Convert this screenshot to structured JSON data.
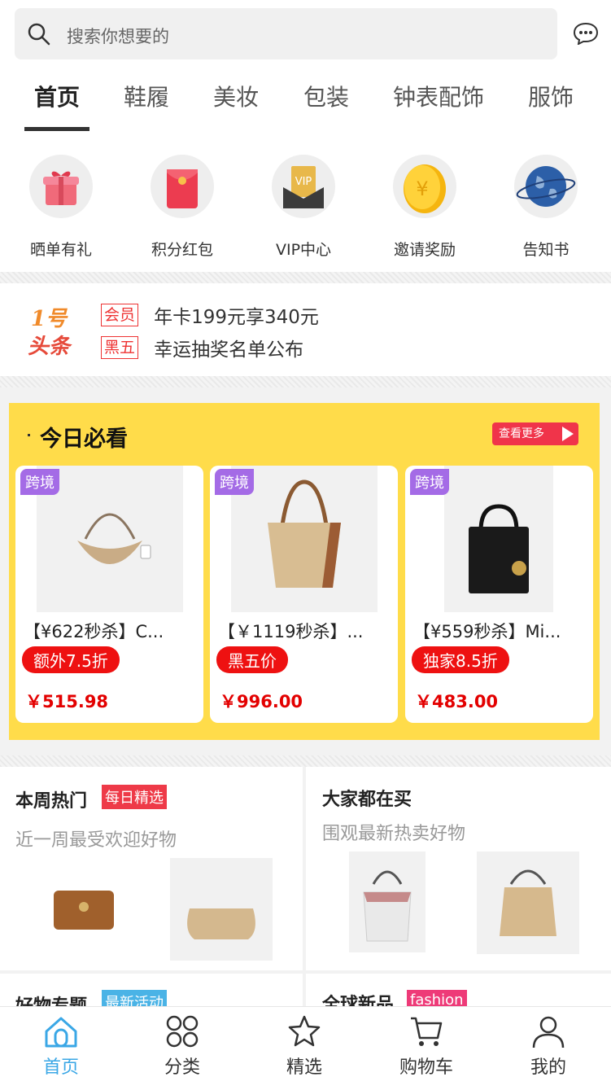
{
  "search": {
    "placeholder": "搜索你想要的"
  },
  "tabs": [
    "首页",
    "鞋履",
    "美妆",
    "包装",
    "钟表配饰",
    "服饰"
  ],
  "quick_links": [
    {
      "label": "晒单有礼",
      "icon": "gift-icon"
    },
    {
      "label": "积分红包",
      "icon": "red-envelope-icon"
    },
    {
      "label": "VIP中心",
      "icon": "vip-card-icon"
    },
    {
      "label": "邀请奖励",
      "icon": "gold-coin-icon"
    },
    {
      "label": "告知书",
      "icon": "globe-icon"
    }
  ],
  "news": {
    "logo_text": "1号头条",
    "items": [
      {
        "tag": "会员",
        "text": "年卡199元享340元"
      },
      {
        "tag": "黑五",
        "text": "幸运抽奖名单公布"
      }
    ]
  },
  "must_see": {
    "title": "今日必看",
    "more": "查看更多",
    "products": [
      {
        "badge": "跨境",
        "name": "【¥622秒杀】C...",
        "promo": "额外7.5折",
        "price": "￥515.98"
      },
      {
        "badge": "跨境",
        "name": "【￥1119秒杀】...",
        "promo": "黑五价",
        "price": "￥996.00"
      },
      {
        "badge": "跨境",
        "name": "【¥559秒杀】Mi...",
        "promo": "独家8.5折",
        "price": "￥483.00"
      }
    ]
  },
  "sections": [
    {
      "title": "本周热门",
      "tag": "每日精选",
      "subtitle": "近一周最受欢迎好物"
    },
    {
      "title": "大家都在买",
      "tag": "",
      "subtitle": "围观最新热卖好物"
    },
    {
      "title": "好物专题",
      "tag": "最新活动",
      "subtitle": ""
    },
    {
      "title": "全球新品",
      "tag": "fashion",
      "subtitle": ""
    }
  ],
  "bottom_nav": [
    {
      "label": "首页",
      "icon": "home-icon",
      "active": true
    },
    {
      "label": "分类",
      "icon": "category-icon",
      "active": false
    },
    {
      "label": "精选",
      "icon": "star-icon",
      "active": false
    },
    {
      "label": "购物车",
      "icon": "cart-icon",
      "active": false
    },
    {
      "label": "我的",
      "icon": "user-icon",
      "active": false
    }
  ],
  "colors": {
    "accent_blue": "#3aa7e6",
    "must_see_bg": "#ffdc4a",
    "promo_red": "#ee1111",
    "price_red": "#e30000",
    "badge_purple": "#a46be6"
  }
}
